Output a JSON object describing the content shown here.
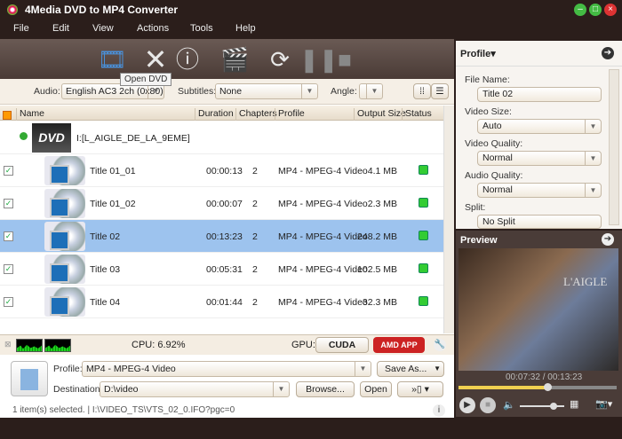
{
  "window": {
    "title": "4Media DVD to MP4 Converter"
  },
  "menu": [
    "File",
    "Edit",
    "View",
    "Actions",
    "Tools",
    "Help"
  ],
  "toolbar": {
    "tooltip": "Open DVD"
  },
  "options": {
    "audio_label": "Audio:",
    "audio_value": "English AC3 2ch (0x80)",
    "subtitles_label": "Subtitles:",
    "subtitles_value": "None",
    "angle_label": "Angle:",
    "angle_value": "1"
  },
  "table": {
    "columns": [
      "Name",
      "Duration",
      "Chapters",
      "Profile",
      "Output Size",
      "Status"
    ],
    "root": "I:[L_AIGLE_DE_LA_9EME]",
    "rows": [
      {
        "name": "Title 01_01",
        "duration": "00:00:13",
        "chapters": "2",
        "profile": "MP4 - MPEG-4 Video",
        "size": "4.1 MB"
      },
      {
        "name": "Title 01_02",
        "duration": "00:00:07",
        "chapters": "2",
        "profile": "MP4 - MPEG-4 Video",
        "size": "2.3 MB"
      },
      {
        "name": "Title 02",
        "duration": "00:13:23",
        "chapters": "2",
        "profile": "MP4 - MPEG-4 Video",
        "size": "248.2 MB",
        "selected": true
      },
      {
        "name": "Title 03",
        "duration": "00:05:31",
        "chapters": "2",
        "profile": "MP4 - MPEG-4 Video",
        "size": "102.5 MB"
      },
      {
        "name": "Title 04",
        "duration": "00:01:44",
        "chapters": "2",
        "profile": "MP4 - MPEG-4 Video",
        "size": "32.3 MB"
      }
    ]
  },
  "cpu": {
    "label": "CPU: 6.92%",
    "gpu_label": "GPU:",
    "cuda": "CUDA",
    "amd": "AMD APP"
  },
  "profile_bar": {
    "profile_label": "Profile:",
    "profile_value": "MP4 - MPEG-4 Video",
    "save_as": "Save As...",
    "destination_label": "Destination:",
    "destination_value": "D:\\video",
    "browse": "Browse...",
    "open": "Open"
  },
  "status": "1 item(s) selected. | I:\\VIDEO_TS\\VTS_02_0.IFO?pgc=0",
  "profile_panel": {
    "header": "Profile▾",
    "file_name_label": "File Name:",
    "file_name": "Title 02",
    "video_size_label": "Video Size:",
    "video_size": "Auto",
    "video_quality_label": "Video Quality:",
    "video_quality": "Normal",
    "audio_quality_label": "Audio Quality:",
    "audio_quality": "Normal",
    "split_label": "Split:",
    "split": "No Split"
  },
  "preview": {
    "header": "Preview",
    "time": "00:07:32 / 00:13:23",
    "progress": 0.563,
    "volume": 0.75,
    "video_caption": "L'AIGLE"
  },
  "colors": {
    "accent_selected": "#9dc3ee",
    "status_ok": "#33cc33",
    "progress": "#f0d050"
  }
}
